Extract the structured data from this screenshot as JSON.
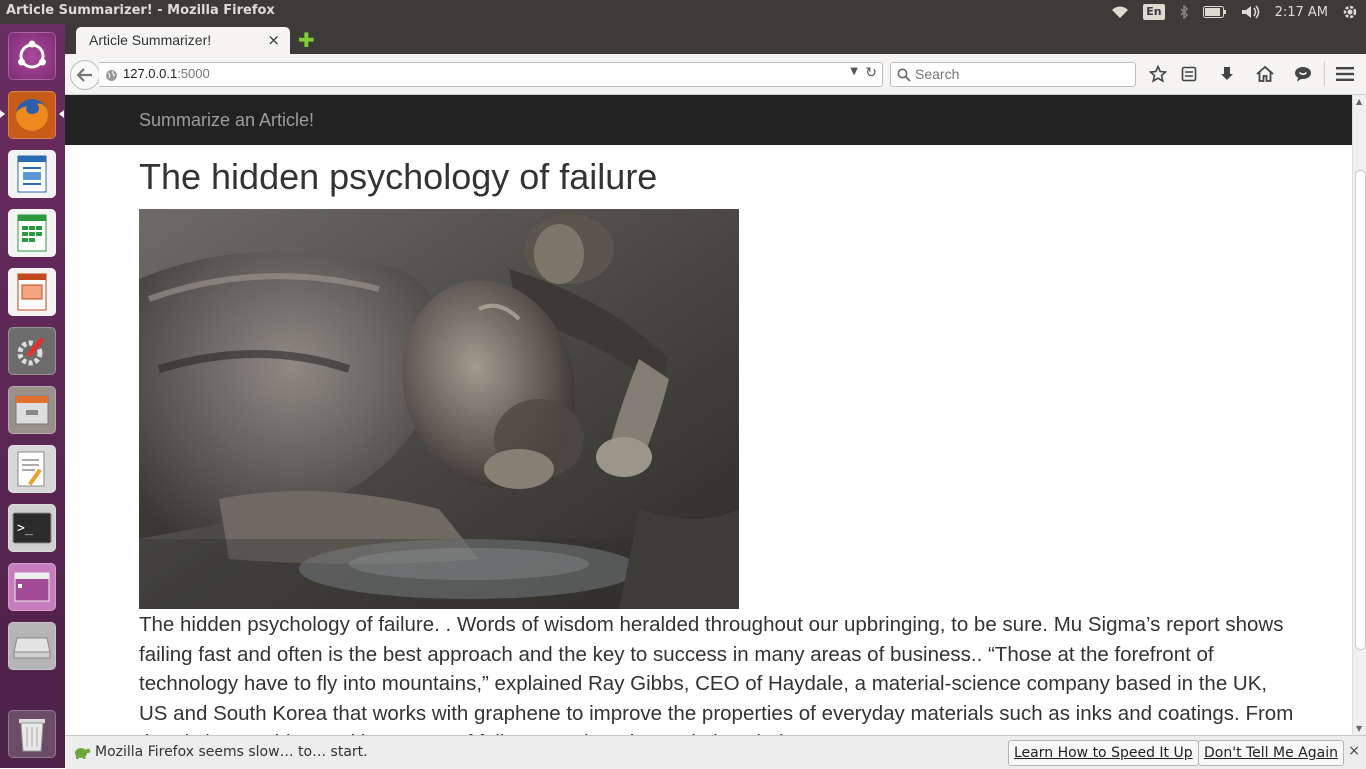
{
  "system": {
    "window_title": "Article Summarizer! - Mozilla Firefox",
    "keyboard_layout": "En",
    "clock": "2:17 AM"
  },
  "launcher": {
    "items": [
      {
        "name": "ubuntu-dash-icon",
        "color": "#e05a2b"
      },
      {
        "name": "firefox-icon",
        "color": "#e8720c"
      },
      {
        "name": "libreoffice-writer-icon",
        "color": "#2a6bb3"
      },
      {
        "name": "libreoffice-calc-icon",
        "color": "#2a9a3c"
      },
      {
        "name": "libreoffice-impress-icon",
        "color": "#c2471c"
      },
      {
        "name": "system-settings-icon",
        "color": "#7a7a7a"
      },
      {
        "name": "file-manager-icon",
        "color": "#8c6a4a"
      },
      {
        "name": "text-editor-icon",
        "color": "#d8d8d8"
      },
      {
        "name": "terminal-icon",
        "color": "#2b2b2b"
      },
      {
        "name": "workspace-switcher-icon",
        "color": "#9a3d8e"
      },
      {
        "name": "disk-icon",
        "color": "#9a9a9a"
      },
      {
        "name": "trash-icon",
        "color": "#b0b0b0"
      }
    ]
  },
  "browser": {
    "tab_title": "Article Summarizer!",
    "tab_close": "×",
    "new_tab": "✚",
    "url_host": "127.0.0.1",
    "url_port": ":5000",
    "search_placeholder": "Search"
  },
  "page": {
    "brand": "Summarize an Article!",
    "title": "The hidden psychology of failure",
    "image_alt": "Man crawling through mud",
    "body": "The hidden psychology of failure. . Words of wisdom heralded throughout our upbringing, to be sure. Mu Sigma’s report shows failing fast and often is the best approach and the key to success in many areas of business.. “Those at the forefront of technology have to fly into mountains,” explained Ray Gibbs, CEO of Haydale, a material-science company based in the UK, US and South Korea that works with graphene to improve the properties of everyday materials such as inks and coatings. From the pitch to Ambient’s ultimate use of failure as a learning tool, the whole process..."
  },
  "notification": {
    "message": "Mozilla Firefox seems slow… to… start.",
    "learn_button": "Learn How to Speed It Up",
    "dismiss_button": "Don't Tell Me Again",
    "close": "×"
  },
  "colors": {
    "top_panel": "#3c3b37",
    "launcher": "#5a2a55",
    "site_nav": "#222222",
    "brand_text": "#9d9d9d"
  }
}
